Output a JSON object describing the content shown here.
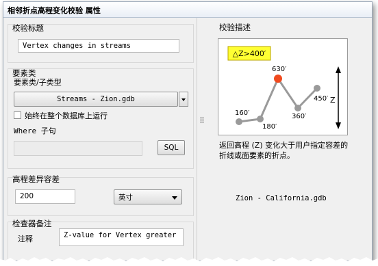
{
  "window": {
    "title": "相邻折点高程变化校验 属性"
  },
  "check_title": {
    "group_label": "校验标题",
    "value": "Vertex changes in streams"
  },
  "feature_class": {
    "group_label": "要素类",
    "sub_label": "要素类/子类型",
    "combo_value": "Streams -  Zion.gdb",
    "checkbox_label": "始终在整个数据库上运行",
    "where_label": "Where 子句",
    "sql_button": "SQL"
  },
  "tolerance": {
    "group_label": "高程差异容差",
    "value": "200",
    "unit": "英寸"
  },
  "notes": {
    "group_label": "检查器备注",
    "label": "注释",
    "value": "Z-value for Vertex greater"
  },
  "description": {
    "header": "校验描述",
    "text_line1": "返回高程 (Z) 变化大于用户指定容差的",
    "text_line2": "折线或面要素的折点。",
    "source": "Zion -  California.gdb"
  },
  "diagram": {
    "callout": "△Z>400′",
    "labels": [
      "160′",
      "180′",
      "630′",
      "360′",
      "450′"
    ],
    "axis_label": "Z",
    "colors": {
      "callout_bg": "#ffff33",
      "highlight": "#f04a1e",
      "line": "#9a9a9a"
    }
  }
}
